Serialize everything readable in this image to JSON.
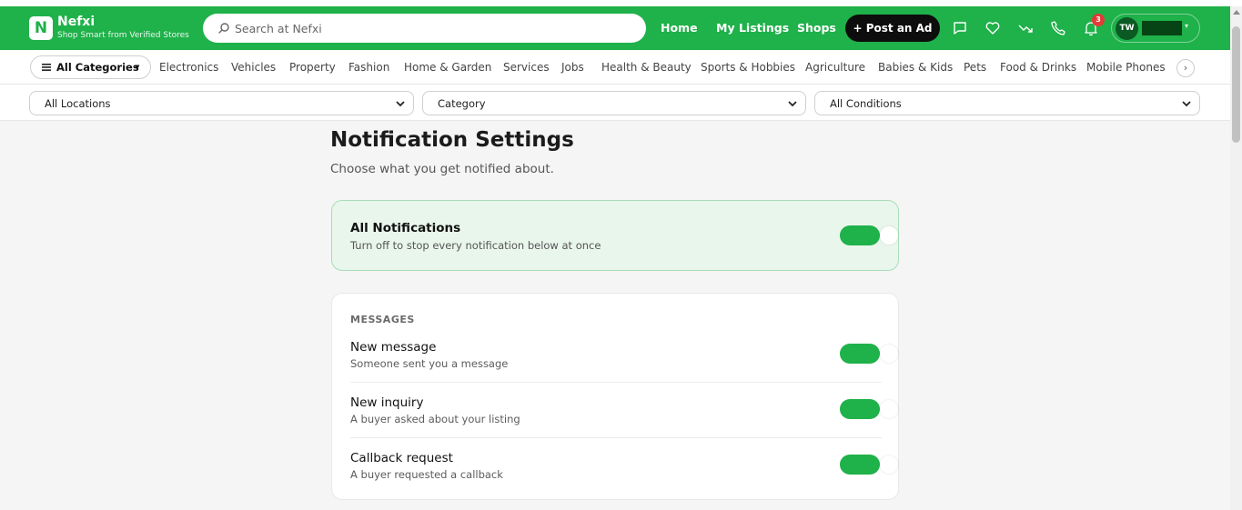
{
  "brand": {
    "name": "Nefxi",
    "logo_letter": "N",
    "tagline": "Shop Smart from Verified Stores",
    "color": "#1fb14a"
  },
  "search": {
    "placeholder": "Search at Nefxi"
  },
  "nav": {
    "home": "Home",
    "my_listings": "My Listings",
    "shops": "Shops",
    "post_ad": "+ Post an Ad"
  },
  "header_icons": [
    "chat-icon",
    "heart-icon",
    "trending-down-icon",
    "phone-icon",
    "bell-icon"
  ],
  "notifications": {
    "count": "3"
  },
  "account": {
    "initials": "TW"
  },
  "categories": {
    "all_label": "All Categories",
    "items": [
      "Electronics",
      "Vehicles",
      "Property",
      "Fashion",
      "Home & Garden",
      "Services",
      "Jobs",
      "Health & Beauty",
      "Sports & Hobbies",
      "Agriculture",
      "Babies & Kids",
      "Pets",
      "Food & Drinks",
      "Mobile Phones"
    ]
  },
  "filters": {
    "location": "All Locations",
    "category": "Category",
    "condition": "All Conditions"
  },
  "page": {
    "title": "Notification Settings",
    "subtitle": "Choose what you get notified about."
  },
  "master": {
    "title": "All Notifications",
    "desc": "Turn off to stop every notification below at once",
    "enabled": true
  },
  "messages": {
    "section": "MESSAGES",
    "items": [
      {
        "title": "New message",
        "desc": "Someone sent you a message",
        "enabled": true
      },
      {
        "title": "New inquiry",
        "desc": "A buyer asked about your listing",
        "enabled": true
      },
      {
        "title": "Callback request",
        "desc": "A buyer requested a callback",
        "enabled": true
      }
    ]
  }
}
